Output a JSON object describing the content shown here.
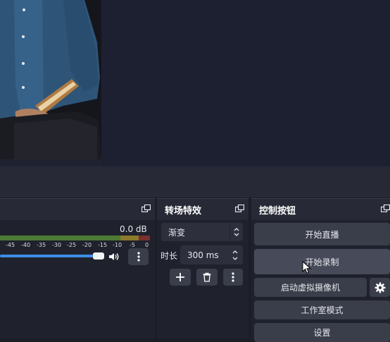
{
  "mixer": {
    "db_value": "0.0 dB",
    "ticks": [
      "-45",
      "-40",
      "-35",
      "-30",
      "-25",
      "-20",
      "-15",
      "-10",
      "-5",
      "0"
    ],
    "volume_level": 0.98
  },
  "transitions": {
    "title": "转场特效",
    "type_value": "渐变",
    "duration_label": "时长",
    "duration_value": "300 ms"
  },
  "controls": {
    "title": "控制按钮",
    "start_streaming": "开始直播",
    "start_recording": "开始录制",
    "start_virtual_cam": "启动虚拟摄像机",
    "studio_mode": "工作室模式",
    "settings": "设置"
  },
  "colors": {
    "accent": "#3c8ee6",
    "meter_green": "#4c7a34",
    "meter_yellow": "#8a7a2a",
    "meter_red": "#7a3030"
  },
  "icons": [
    "float-dock-icon",
    "updown-arrows-icon",
    "plus-icon",
    "trash-icon",
    "more-vertical-icon",
    "speaker-icon",
    "gear-icon",
    "mouse-cursor-icon"
  ]
}
